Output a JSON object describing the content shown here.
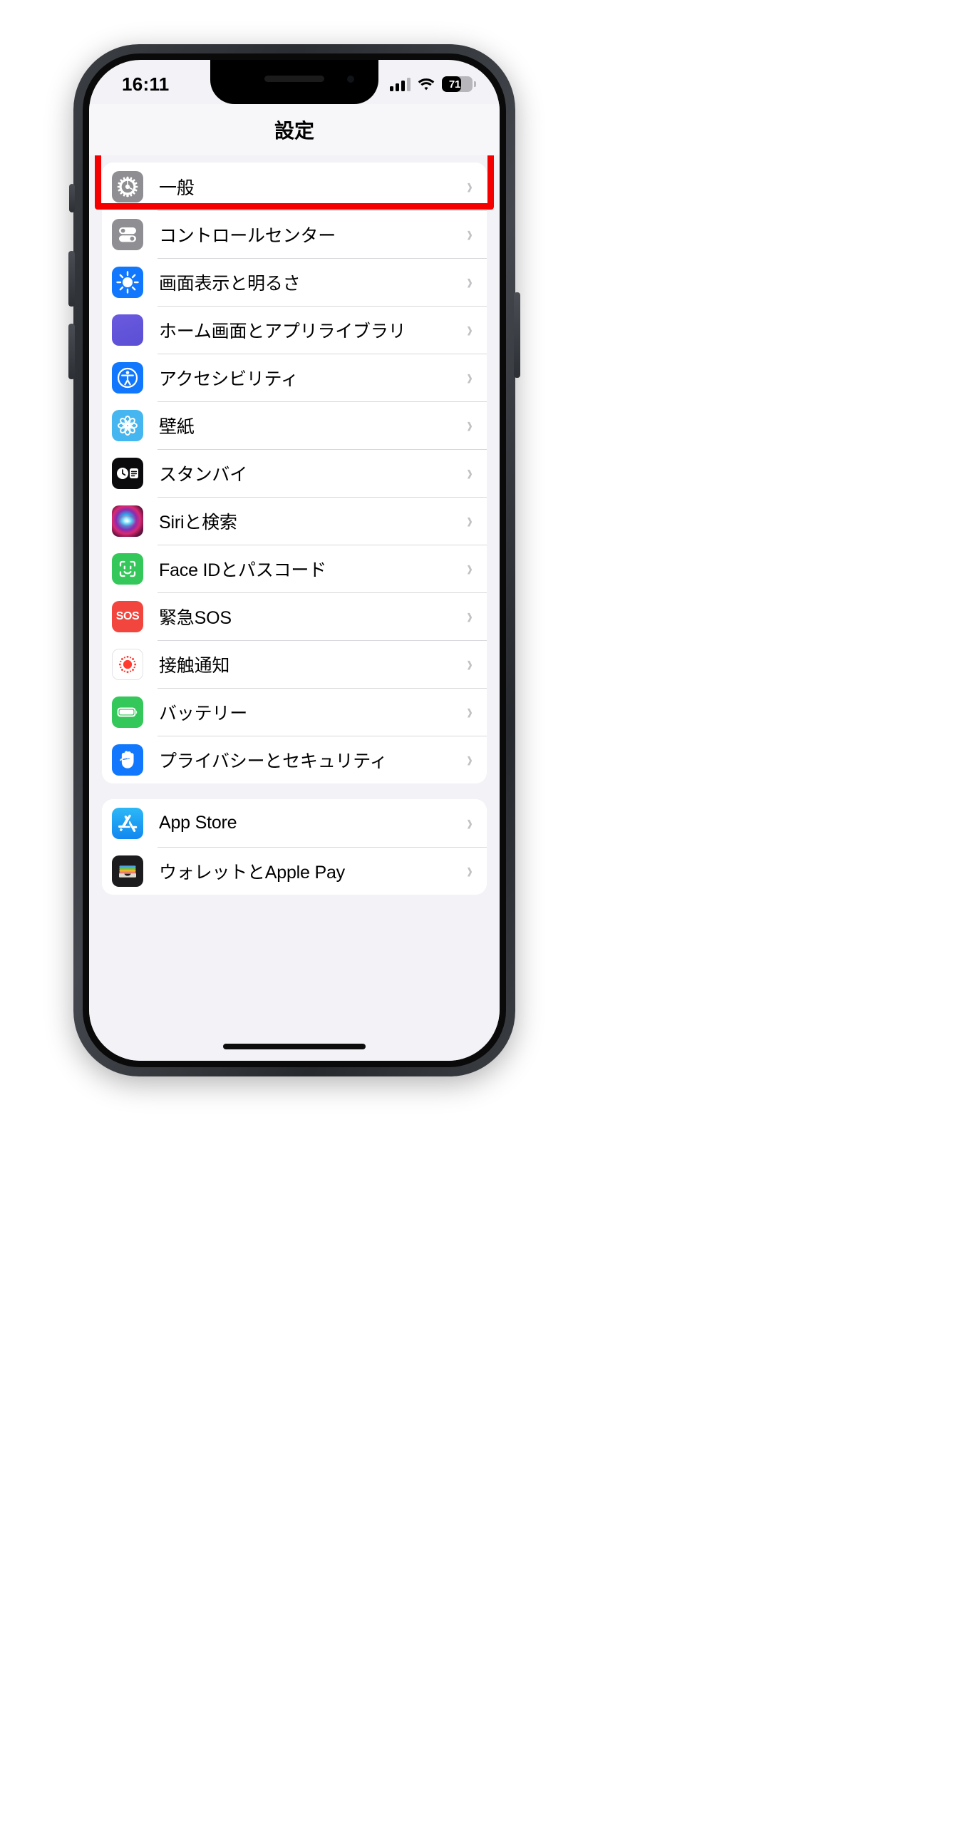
{
  "status_bar": {
    "time": "16:11",
    "signal_icon": "cellular-signal-icon",
    "signal_bars_filled": 3,
    "signal_bars_total": 4,
    "wifi_icon": "wifi-icon",
    "battery_percent": "71",
    "battery_level": 71
  },
  "navbar": {
    "title": "設定"
  },
  "colors": {
    "highlight": "#f50000",
    "page_background": "#f2f2f7",
    "row_background": "#ffffff",
    "separator": "#d8d8dc",
    "chevron": "#c2c2c6"
  },
  "groups": [
    {
      "id": "group-system",
      "rows": [
        {
          "label": "一般",
          "icon": "gear-icon",
          "icon_color": "#8e8e93",
          "chevron": "›"
        },
        {
          "label": "コントロールセンター",
          "icon": "control-center-icon",
          "icon_color": "#8e8e93",
          "chevron": "›"
        },
        {
          "label": "画面表示と明るさ",
          "icon": "brightness-icon",
          "icon_color": "#1178fd",
          "chevron": "›"
        },
        {
          "label": "ホーム画面とアプリライブラリ",
          "icon": "app-grid-icon",
          "icon_color": "#5b4fd4",
          "chevron": "›"
        },
        {
          "label": "アクセシビリティ",
          "icon": "accessibility-icon",
          "icon_color": "#1178fd",
          "chevron": "›"
        },
        {
          "label": "壁紙",
          "icon": "wallpaper-flower-icon",
          "icon_color": "#45b6ef",
          "chevron": "›"
        },
        {
          "label": "スタンバイ",
          "icon": "standby-icon",
          "icon_color": "#0b0b0d",
          "chevron": "›"
        },
        {
          "label": "Siriと検索",
          "icon": "siri-orb-icon",
          "icon_color": "#d92a73",
          "chevron": "›"
        },
        {
          "label": "Face IDとパスコード",
          "icon": "face-id-icon",
          "icon_color": "#34c759",
          "chevron": "›"
        },
        {
          "label": "緊急SOS",
          "icon": "sos-icon",
          "icon_color": "#f1453d",
          "chevron": "›",
          "icon_text": "SOS"
        },
        {
          "label": "接触通知",
          "icon": "exposure-notification-icon",
          "icon_color": "#ff3b30",
          "chevron": "›"
        },
        {
          "label": "バッテリー",
          "icon": "battery-icon",
          "icon_color": "#34c759",
          "chevron": "›"
        },
        {
          "label": "プライバシーとセキュリティ",
          "icon": "privacy-hand-icon",
          "icon_color": "#1178fd",
          "chevron": "›"
        }
      ]
    },
    {
      "id": "group-stores",
      "rows": [
        {
          "label": "App Store",
          "icon": "app-store-icon",
          "icon_color": "#1aa0f5",
          "chevron": "›",
          "highlighted": true
        },
        {
          "label": "ウォレットとApple Pay",
          "icon": "wallet-icon",
          "icon_color": "#1c1c1e",
          "chevron": "›"
        }
      ]
    }
  ],
  "home_indicator": "home-indicator"
}
